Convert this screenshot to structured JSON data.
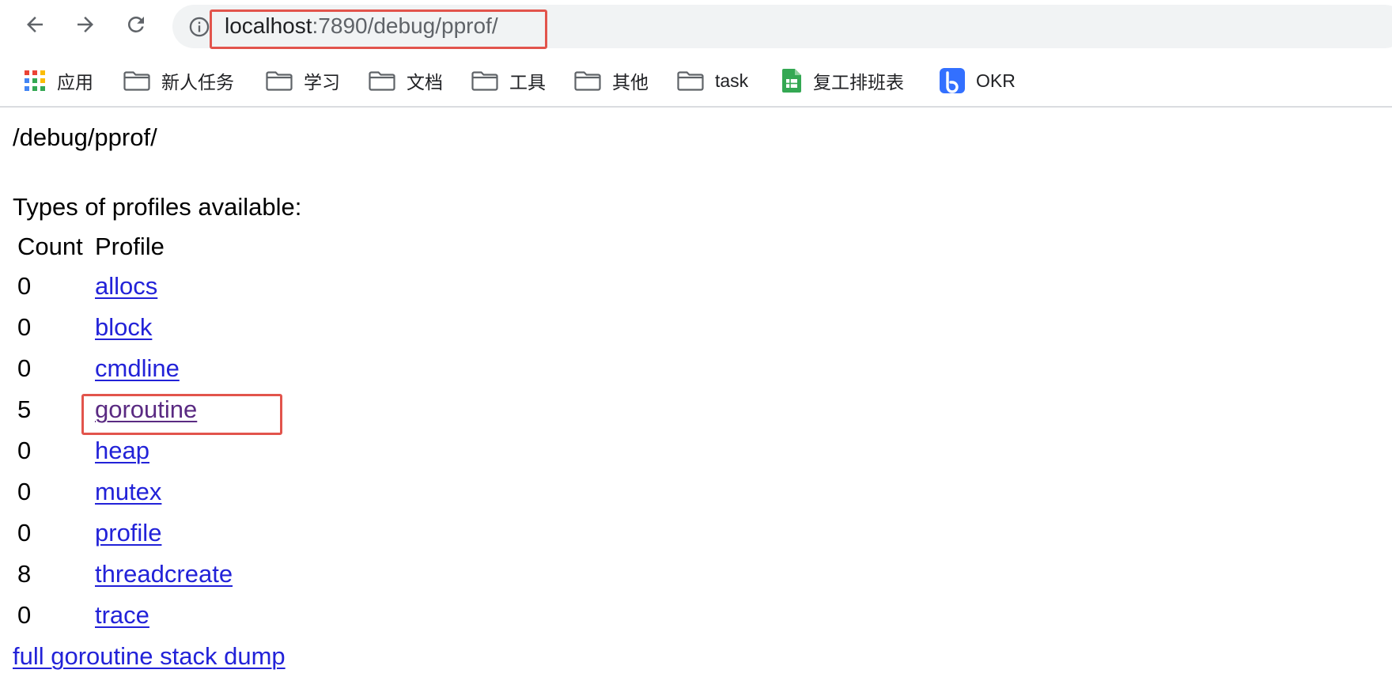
{
  "browser": {
    "url": {
      "host": "localhost",
      "rest": ":7890/debug/pprof/"
    },
    "bookmarks": [
      {
        "label": "应用",
        "icon": "apps-grid-icon"
      },
      {
        "label": "新人任务",
        "icon": "folder-icon"
      },
      {
        "label": "学习",
        "icon": "folder-icon"
      },
      {
        "label": "文档",
        "icon": "folder-icon"
      },
      {
        "label": "工具",
        "icon": "folder-icon"
      },
      {
        "label": "其他",
        "icon": "folder-icon"
      },
      {
        "label": "task",
        "icon": "folder-icon"
      },
      {
        "label": "复工排班表",
        "icon": "spreadsheet-icon"
      },
      {
        "label": "OKR",
        "icon": "okr-app-icon"
      }
    ],
    "colors": {
      "highlight": "#e2544c",
      "link": "#2222d8",
      "visited_link": "#5a2a82",
      "omnibox_bg": "#f1f3f4"
    }
  },
  "page": {
    "path": "/debug/pprof/",
    "section_title": "Types of profiles available:",
    "table": {
      "headers": {
        "count": "Count",
        "profile": "Profile"
      },
      "rows": [
        {
          "count": "0",
          "profile": "allocs"
        },
        {
          "count": "0",
          "profile": "block"
        },
        {
          "count": "0",
          "profile": "cmdline"
        },
        {
          "count": "5",
          "profile": "goroutine"
        },
        {
          "count": "0",
          "profile": "heap"
        },
        {
          "count": "0",
          "profile": "mutex"
        },
        {
          "count": "0",
          "profile": "profile"
        },
        {
          "count": "8",
          "profile": "threadcreate"
        },
        {
          "count": "0",
          "profile": "trace"
        }
      ]
    },
    "dump_link": "full goroutine stack dump"
  }
}
